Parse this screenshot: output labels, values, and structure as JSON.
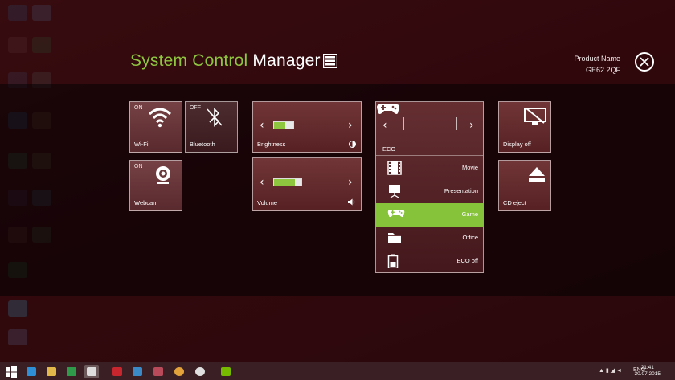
{
  "header": {
    "title_accent": "System Control",
    "title_rest": "Manager",
    "product_label": "Product Name",
    "product_value": "GE62 2QF"
  },
  "tiles": {
    "wifi": {
      "state": "ON",
      "label": "Wi-Fi"
    },
    "bluetooth": {
      "state": "OFF",
      "label": "Bluetooth"
    },
    "webcam": {
      "state": "ON",
      "label": "Webcam"
    },
    "brightness": {
      "label": "Brightness",
      "level": 0.2
    },
    "volume": {
      "label": "Volume",
      "level": 0.3
    },
    "display_off": {
      "label": "Display off"
    },
    "cd_eject": {
      "label": "CD eject"
    }
  },
  "eco": {
    "label": "ECO",
    "modes": [
      {
        "label": "Movie",
        "icon": "film-icon"
      },
      {
        "label": "Presentation",
        "icon": "projector-icon"
      },
      {
        "label": "Game",
        "icon": "gamepad-icon"
      },
      {
        "label": "Office",
        "icon": "folder-icon"
      },
      {
        "label": "ECO off",
        "icon": "battery-icon"
      }
    ],
    "selected": "Game"
  },
  "taskbar": {
    "lang": "ENG",
    "time": "21:41",
    "date": "30.07.2015"
  },
  "colors": {
    "accent": "#8ec63f",
    "selected_row": "#86c23a",
    "background": "#3b0d12"
  }
}
